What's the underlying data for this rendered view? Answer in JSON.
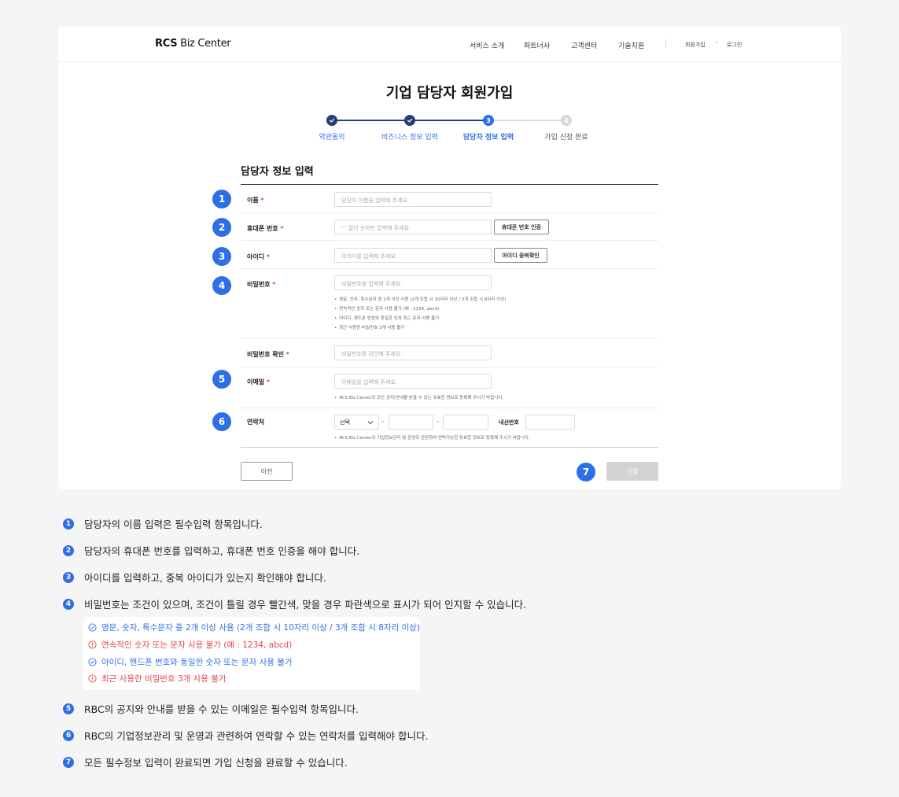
{
  "header": {
    "logo_bold": "RCS",
    "logo_rest": " Biz Center",
    "nav": [
      "서비스 소개",
      "파트너사",
      "고객센터",
      "기술지원"
    ],
    "signup": "회원가입",
    "login": "로그인"
  },
  "page_title": "기업 담당자 회원가입",
  "steps": [
    {
      "label": "약관동의",
      "state": "done"
    },
    {
      "label": "비즈니스 정보 입력",
      "state": "done"
    },
    {
      "label": "담당자 정보 입력",
      "state": "current",
      "num": "3"
    },
    {
      "label": "가입 신청 완료",
      "state": "todo",
      "num": "4"
    }
  ],
  "section_title": "담당자 정보 입력",
  "form": {
    "name": {
      "badge": "1",
      "label": "이름",
      "req": " *",
      "placeholder": "담당자 이름을 입력해 주세요."
    },
    "phone": {
      "badge": "2",
      "label": "휴대폰 번호",
      "req": " *",
      "placeholder": "'-' 없이 숫자만 입력해 주세요.",
      "button": "휴대폰 번호 인증"
    },
    "userid": {
      "badge": "3",
      "label": "아이디",
      "req": " *",
      "placeholder": "아이디를 입력해 주세요.",
      "button": "아이디 중복확인"
    },
    "password": {
      "badge": "4",
      "label": "비밀번호",
      "req": " *",
      "placeholder": "비밀번호를 입력해 주세요.",
      "hints": [
        "영문, 숫자, 특수문자 중 2개 이상 사용 (2개 조합 시 10자리 이상 / 3개 조합 시 8자리 이상)",
        "연속적인 숫자 또는 문자 사용 불가 (예 : 1234, abcd)",
        "아이디, 핸드폰 번호와 동일한 숫자 또는 문자 사용 불가",
        "최근 사용한 비밀번호 3개 사용 불가"
      ]
    },
    "password_confirm": {
      "label": "비밀번호 확인",
      "req": " *",
      "placeholder": "비밀번호를 확인해 주세요."
    },
    "email": {
      "badge": "5",
      "label": "이메일",
      "req": " *",
      "placeholder": "이메일을 입력해 주세요.",
      "hint": "RCS Biz Center의 모든 공지/안내를 받을 수 있는 유효한 정보로 등록해 주시기 바랍니다."
    },
    "contact": {
      "badge": "6",
      "label": "연락처",
      "select": "선택",
      "dash": "-",
      "ext_label": "내선번호",
      "hint": "RCS Biz Center의 기업정보관리 및 운영과 관련하여 연락가능한 유효한 정보로 등록해 주시기 바랍니다."
    }
  },
  "buttons": {
    "prev": "이전",
    "apply": "신청",
    "apply_badge": "7"
  },
  "descriptions": [
    {
      "num": "1",
      "text": "담당자의 이름 입력은 필수입력 항목입니다."
    },
    {
      "num": "2",
      "text": "담당자의 휴대폰 번호를 입력하고, 휴대폰 번호 인증을 해야 합니다."
    },
    {
      "num": "3",
      "text": "아이디를 입력하고, 중복 아이디가 있는지 확인해야 합니다."
    },
    {
      "num": "4",
      "text": "비밀번호는 조건이 있으며, 조건이 틀릴 경우 빨간색, 맞을 경우 파란색으로 표시가 되어 인지할 수 있습니다."
    },
    {
      "num": "5",
      "text": "RBC의 공지와 안내를 받을 수 있는 이메일은 필수입력 항목입니다."
    },
    {
      "num": "6",
      "text": "RBC의 기업정보관리 및 운영과 관련하여 연락할 수 있는 연락처를 입력해야 합니다."
    },
    {
      "num": "7",
      "text": "모든 필수정보 입력이 완료되면 가입 신청을 완료할 수 있습니다."
    }
  ],
  "password_rules": [
    {
      "text": "영문, 숫자, 특수문자 중 2개 이상 사용 (2개 조합 시 10자리 이상 / 3개 조합 시 8자리 이상)",
      "status": "ok"
    },
    {
      "text": "연속적인 숫자 또는 문자 사용 불가 (예 : 1234, abcd)",
      "status": "bad"
    },
    {
      "text": "아이디, 핸드폰 번호와 동일한 숫자 또는 문자 사용 불가",
      "status": "ok"
    },
    {
      "text": "최근 사용한 비밀번호 3개 사용 불가",
      "status": "bad"
    }
  ],
  "colors": {
    "accent": "#2f6fe6",
    "step_done": "#2a3e73",
    "error": "#e5484d",
    "disabled": "#d3d3d3"
  }
}
